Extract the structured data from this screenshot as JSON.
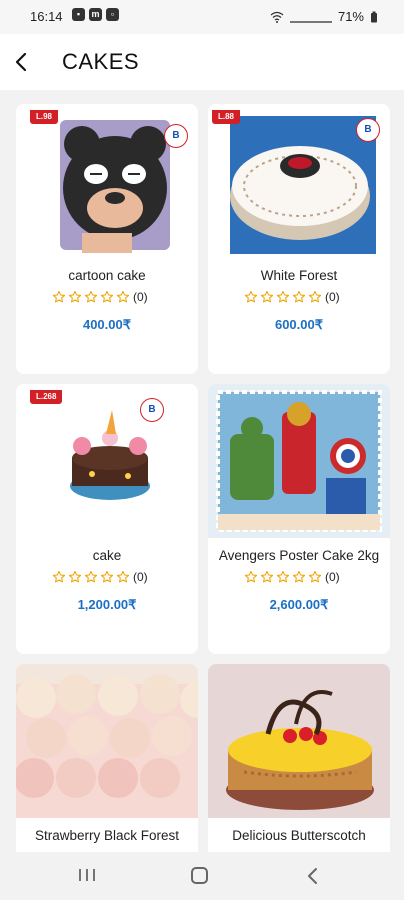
{
  "status": {
    "time": "16:14",
    "battery": "71%",
    "notif_icons": [
      "sms-icon",
      "messenger-icon",
      "gallery-icon"
    ]
  },
  "header": {
    "title": "CAKES"
  },
  "products": [
    {
      "name": "cartoon cake",
      "rating_count": "(0)",
      "price": "400.00₹",
      "badge": "L.98",
      "rating": 0
    },
    {
      "name": "White Forest",
      "rating_count": "(0)",
      "price": "600.00₹",
      "badge": "L.88",
      "rating": 0
    },
    {
      "name": "cake",
      "rating_count": "(0)",
      "price": "1,200.00₹",
      "badge": "L.268",
      "rating": 0
    },
    {
      "name": "Avengers Poster Cake 2kg",
      "rating_count": "(0)",
      "price": "2,600.00₹",
      "badge": "",
      "rating": 0
    },
    {
      "name": "Strawberry Black Forest",
      "rating_count": "",
      "price": "",
      "badge": "",
      "rating": 0
    },
    {
      "name": "Delicious Butterscotch",
      "rating_count": "",
      "price": "",
      "badge": "",
      "rating": 0
    }
  ],
  "colors": {
    "accent_price": "#1c6fc2",
    "star": "#f0a400",
    "badge": "#d32027"
  }
}
